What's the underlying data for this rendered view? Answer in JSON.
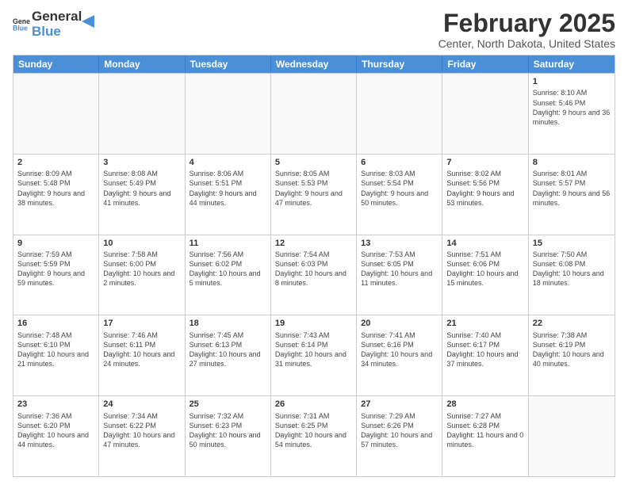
{
  "header": {
    "logo_line1": "General",
    "logo_line2": "Blue",
    "month_title": "February 2025",
    "location": "Center, North Dakota, United States"
  },
  "weekdays": [
    "Sunday",
    "Monday",
    "Tuesday",
    "Wednesday",
    "Thursday",
    "Friday",
    "Saturday"
  ],
  "rows": [
    [
      {
        "day": "",
        "info": ""
      },
      {
        "day": "",
        "info": ""
      },
      {
        "day": "",
        "info": ""
      },
      {
        "day": "",
        "info": ""
      },
      {
        "day": "",
        "info": ""
      },
      {
        "day": "",
        "info": ""
      },
      {
        "day": "1",
        "info": "Sunrise: 8:10 AM\nSunset: 5:46 PM\nDaylight: 9 hours and 36 minutes."
      }
    ],
    [
      {
        "day": "2",
        "info": "Sunrise: 8:09 AM\nSunset: 5:48 PM\nDaylight: 9 hours and 38 minutes."
      },
      {
        "day": "3",
        "info": "Sunrise: 8:08 AM\nSunset: 5:49 PM\nDaylight: 9 hours and 41 minutes."
      },
      {
        "day": "4",
        "info": "Sunrise: 8:06 AM\nSunset: 5:51 PM\nDaylight: 9 hours and 44 minutes."
      },
      {
        "day": "5",
        "info": "Sunrise: 8:05 AM\nSunset: 5:53 PM\nDaylight: 9 hours and 47 minutes."
      },
      {
        "day": "6",
        "info": "Sunrise: 8:03 AM\nSunset: 5:54 PM\nDaylight: 9 hours and 50 minutes."
      },
      {
        "day": "7",
        "info": "Sunrise: 8:02 AM\nSunset: 5:56 PM\nDaylight: 9 hours and 53 minutes."
      },
      {
        "day": "8",
        "info": "Sunrise: 8:01 AM\nSunset: 5:57 PM\nDaylight: 9 hours and 56 minutes."
      }
    ],
    [
      {
        "day": "9",
        "info": "Sunrise: 7:59 AM\nSunset: 5:59 PM\nDaylight: 9 hours and 59 minutes."
      },
      {
        "day": "10",
        "info": "Sunrise: 7:58 AM\nSunset: 6:00 PM\nDaylight: 10 hours and 2 minutes."
      },
      {
        "day": "11",
        "info": "Sunrise: 7:56 AM\nSunset: 6:02 PM\nDaylight: 10 hours and 5 minutes."
      },
      {
        "day": "12",
        "info": "Sunrise: 7:54 AM\nSunset: 6:03 PM\nDaylight: 10 hours and 8 minutes."
      },
      {
        "day": "13",
        "info": "Sunrise: 7:53 AM\nSunset: 6:05 PM\nDaylight: 10 hours and 11 minutes."
      },
      {
        "day": "14",
        "info": "Sunrise: 7:51 AM\nSunset: 6:06 PM\nDaylight: 10 hours and 15 minutes."
      },
      {
        "day": "15",
        "info": "Sunrise: 7:50 AM\nSunset: 6:08 PM\nDaylight: 10 hours and 18 minutes."
      }
    ],
    [
      {
        "day": "16",
        "info": "Sunrise: 7:48 AM\nSunset: 6:10 PM\nDaylight: 10 hours and 21 minutes."
      },
      {
        "day": "17",
        "info": "Sunrise: 7:46 AM\nSunset: 6:11 PM\nDaylight: 10 hours and 24 minutes."
      },
      {
        "day": "18",
        "info": "Sunrise: 7:45 AM\nSunset: 6:13 PM\nDaylight: 10 hours and 27 minutes."
      },
      {
        "day": "19",
        "info": "Sunrise: 7:43 AM\nSunset: 6:14 PM\nDaylight: 10 hours and 31 minutes."
      },
      {
        "day": "20",
        "info": "Sunrise: 7:41 AM\nSunset: 6:16 PM\nDaylight: 10 hours and 34 minutes."
      },
      {
        "day": "21",
        "info": "Sunrise: 7:40 AM\nSunset: 6:17 PM\nDaylight: 10 hours and 37 minutes."
      },
      {
        "day": "22",
        "info": "Sunrise: 7:38 AM\nSunset: 6:19 PM\nDaylight: 10 hours and 40 minutes."
      }
    ],
    [
      {
        "day": "23",
        "info": "Sunrise: 7:36 AM\nSunset: 6:20 PM\nDaylight: 10 hours and 44 minutes."
      },
      {
        "day": "24",
        "info": "Sunrise: 7:34 AM\nSunset: 6:22 PM\nDaylight: 10 hours and 47 minutes."
      },
      {
        "day": "25",
        "info": "Sunrise: 7:32 AM\nSunset: 6:23 PM\nDaylight: 10 hours and 50 minutes."
      },
      {
        "day": "26",
        "info": "Sunrise: 7:31 AM\nSunset: 6:25 PM\nDaylight: 10 hours and 54 minutes."
      },
      {
        "day": "27",
        "info": "Sunrise: 7:29 AM\nSunset: 6:26 PM\nDaylight: 10 hours and 57 minutes."
      },
      {
        "day": "28",
        "info": "Sunrise: 7:27 AM\nSunset: 6:28 PM\nDaylight: 11 hours and 0 minutes."
      },
      {
        "day": "",
        "info": ""
      }
    ]
  ]
}
